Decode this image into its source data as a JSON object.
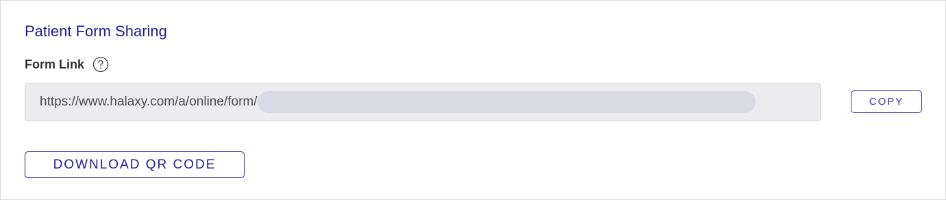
{
  "section": {
    "title": "Patient Form Sharing"
  },
  "form_link": {
    "label": "Form Link",
    "help_icon": "question-circle-icon",
    "url_prefix": "https://www.halaxy.com/a/online/form/",
    "url_suffix_redacted": true
  },
  "actions": {
    "copy_label": "COPY",
    "download_qr_label": "DOWNLOAD QR CODE"
  },
  "colors": {
    "title": "#231a8f",
    "accent": "#3a31c2",
    "input_bg": "#ececef",
    "redaction": "#dadae4"
  }
}
